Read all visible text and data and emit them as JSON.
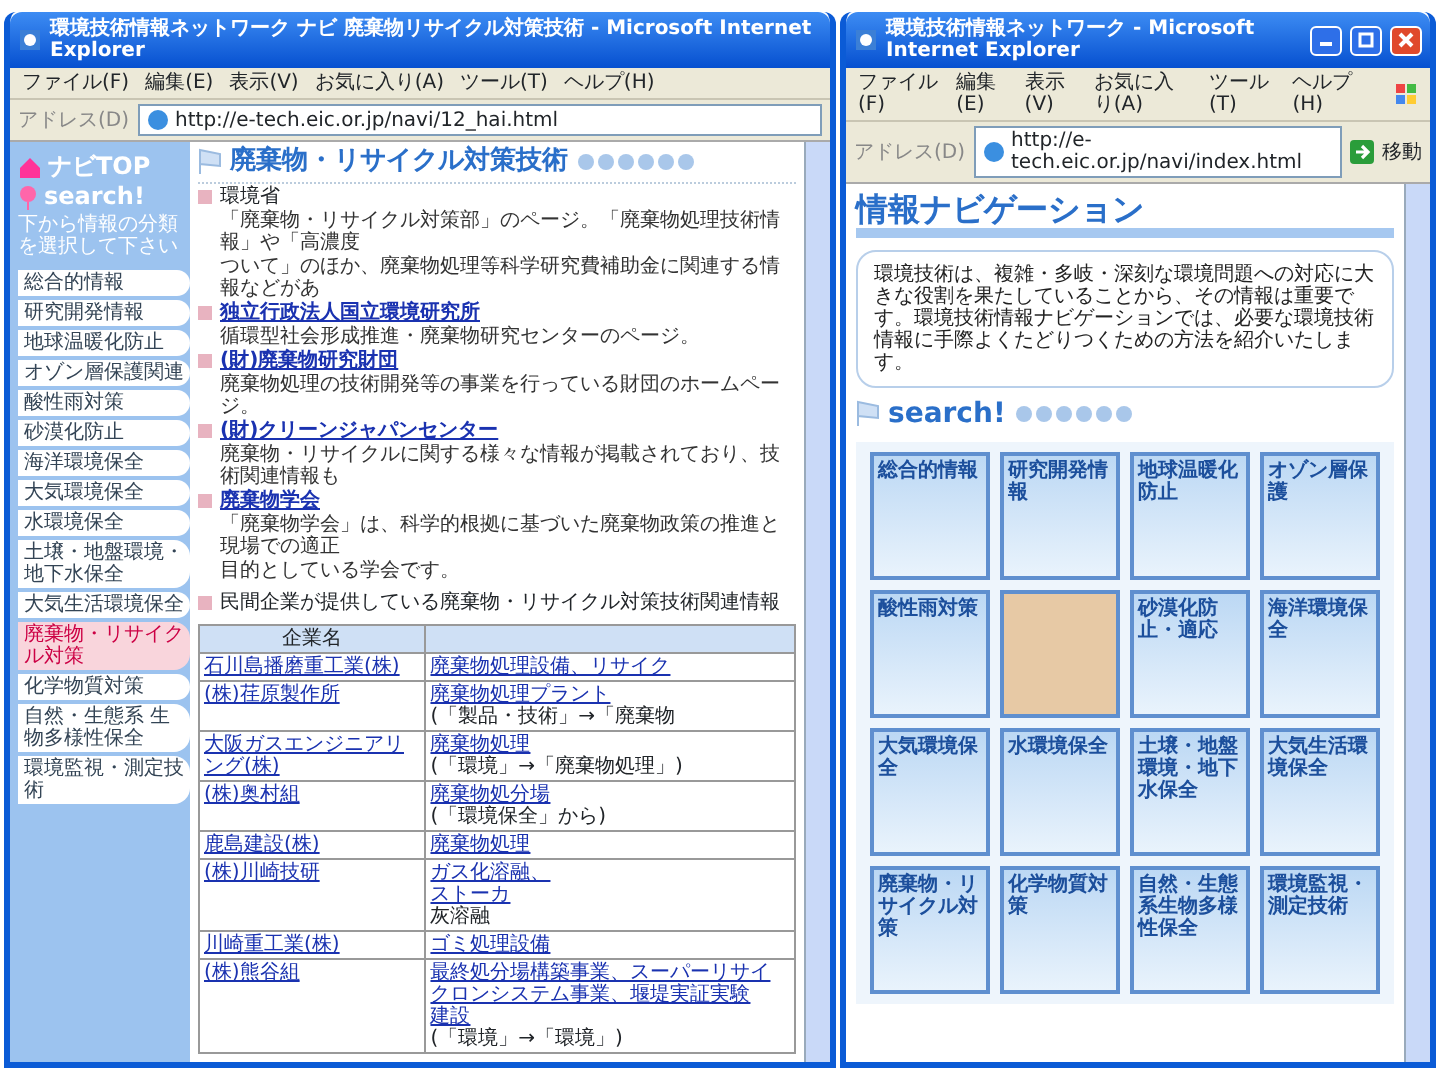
{
  "navi_page_window": {
    "title": "環境技術情報ネットワーク ナビ 廃棄物リサイクル対策技術 - Microsoft Internet Explorer",
    "menu": [
      "ファイル(F)",
      "編集(E)",
      "表示(V)",
      "お気に入り(A)",
      "ツール(T)",
      "ヘルプ(H)"
    ],
    "address": {
      "label": "アドレス(D)",
      "url": "http://e-tech.eic.or.jp/navi/12_hai.html"
    },
    "sidebar": {
      "top_link": "ナビTOP",
      "search_title": "search!",
      "hint": "下から情報の分類を選択して下さい",
      "items": [
        {
          "label": "総合的情報",
          "selected": false
        },
        {
          "label": "研究開発情報",
          "selected": false
        },
        {
          "label": "地球温暖化防止",
          "selected": false
        },
        {
          "label": "オゾン層保護関連",
          "selected": false
        },
        {
          "label": "酸性雨対策",
          "selected": false
        },
        {
          "label": "砂漠化防止",
          "selected": false
        },
        {
          "label": "海洋環境保全",
          "selected": false
        },
        {
          "label": "大気環境保全",
          "selected": false
        },
        {
          "label": "水環境保全",
          "selected": false
        },
        {
          "label": "土壌・地盤環境・地下水保全",
          "selected": false
        },
        {
          "label": "大気生活環境保全",
          "selected": false
        },
        {
          "label": "廃棄物・リサイクル対策",
          "selected": true
        },
        {
          "label": "化学物質対策",
          "selected": false
        },
        {
          "label": "自然・生態系 生物多様性保全",
          "selected": false
        },
        {
          "label": "環境監視・測定技術",
          "selected": false
        }
      ]
    },
    "content": {
      "heading": "廃棄物・リサイクル対策技術",
      "entries": [
        {
          "kind": "plain",
          "title": "環境省",
          "lines": [
            "「廃棄物・リサイクル対策部」のページ。「廃棄物処理技術情報」や「高濃度",
            "ついて」のほか、廃棄物処理等科学研究費補助金に関連する情報などがあ"
          ]
        },
        {
          "kind": "link",
          "title": "独立行政法人国立環境研究所",
          "lines": [
            "循環型社会形成推進・廃棄物研究センターのページ。"
          ]
        },
        {
          "kind": "link",
          "title": "(財)廃棄物研究財団",
          "lines": [
            "廃棄物処理の技術開発等の事業を行っている財団のホームページ。"
          ]
        },
        {
          "kind": "link",
          "title": "(財)クリーンジャパンセンター",
          "lines": [
            "廃棄物・リサイクルに関する様々な情報が掲載されており、技術関連情報も"
          ]
        },
        {
          "kind": "link",
          "title": "廃棄物学会",
          "lines": [
            "「廃棄物学会」は、科学的根拠に基づいた廃棄物政策の推進と現場での適正",
            "目的としている学会です。"
          ]
        }
      ],
      "section_title": "民間企業が提供している廃棄物・リサイクル対策技術関連情報",
      "table": {
        "columns": [
          "企業名"
        ],
        "rows": [
          {
            "cells": [
              [
                "石川島播磨重工業(株)"
              ],
              [
                "廃棄物処理設備、リサイク"
              ]
            ]
          },
          {
            "cells": [
              [
                "(株)荏原製作所"
              ],
              [
                "廃棄物処理プラント",
                "(「製品・技術」→「廃棄物"
              ]
            ]
          },
          {
            "cells": [
              [
                "大阪ガスエンジニアリング(株)"
              ],
              [
                "廃棄物処理",
                "(「環境」→「廃棄物処理」)"
              ]
            ]
          },
          {
            "cells": [
              [
                "(株)奥村組"
              ],
              [
                "廃棄物処分場",
                "(「環境保全」から)"
              ]
            ]
          },
          {
            "cells": [
              [
                "鹿島建設(株)"
              ],
              [
                "廃棄物処理"
              ]
            ]
          },
          {
            "cells": [
              [
                "(株)川崎技研"
              ],
              [
                "ガス化溶融、",
                "ストーカ",
                "灰溶融"
              ]
            ]
          },
          {
            "cells": [
              [
                "川崎重工業(株)"
              ],
              [
                "ゴミ処理設備"
              ]
            ]
          },
          {
            "cells": [
              [
                "(株)熊谷組"
              ],
              [
                "最終処分場構築事業、スーパーリサイクロンシステム事業、堰堤実証実験",
                "建設",
                "(「環境」→「環境」)"
              ]
            ]
          }
        ]
      }
    }
  },
  "index_window": {
    "title": "環境技術情報ネットワーク - Microsoft Internet Explorer",
    "menu": [
      "ファイル(F)",
      "編集(E)",
      "表示(V)",
      "お気に入り(A)",
      "ツール(T)",
      "ヘルプ(H)"
    ],
    "address": {
      "label": "アドレス(D)",
      "url": "http://e-tech.eic.or.jp/navi/index.html",
      "go": "移動"
    },
    "heading": "情報ナビゲーション",
    "intro": "環境技術は、複雑・多岐・深刻な環境問題への対応に大きな役割を果たしていることから、その情報は重要です。環境技術情報ナビゲーションでは、必要な環境技術情報に手際よくたどりつくための方法を紹介いたします。",
    "search_title": "search!",
    "tiles": [
      {
        "kind": "label",
        "label": "総合的情報"
      },
      {
        "kind": "label",
        "label": "研究開発情報"
      },
      {
        "kind": "label",
        "label": "地球温暖化防止"
      },
      {
        "kind": "label",
        "label": "オゾン層保護"
      },
      {
        "kind": "label",
        "label": "酸性雨対策"
      },
      {
        "kind": "photo"
      },
      {
        "kind": "label",
        "label": "砂漠化防止・適応"
      },
      {
        "kind": "label",
        "label": "海洋環境保全"
      },
      {
        "kind": "label",
        "label": "大気環境保全"
      },
      {
        "kind": "label",
        "label": "水環境保全"
      },
      {
        "kind": "label",
        "label": "土壌・地盤環境・地下水保全"
      },
      {
        "kind": "label",
        "label": "大気生活環境保全"
      },
      {
        "kind": "label",
        "label": "廃棄物・リサイクル対策"
      },
      {
        "kind": "label",
        "label": "化学物質対策"
      },
      {
        "kind": "label",
        "label": "自然・生態系生物多様性保全"
      },
      {
        "kind": "label",
        "label": "環境監視・測定技術"
      }
    ]
  }
}
